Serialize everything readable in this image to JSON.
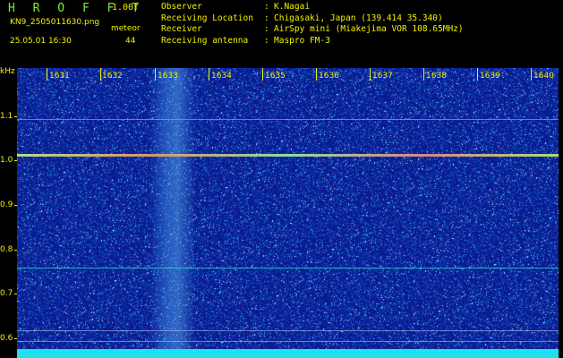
{
  "app": {
    "brand": "H R O F F T",
    "version": "1.00f",
    "filename": "KN9_2505011630.png",
    "station": "meteor",
    "datetime": "25.05.01 16:30",
    "count": "44"
  },
  "info": [
    {
      "label": "Observer",
      "value": "K.Nagai"
    },
    {
      "label": "Receiving Location",
      "value": "Chigasaki, Japan (139.414 35.340)"
    },
    {
      "label": "Receiver",
      "value": "AirSpy mini (Miakejima VOR 108.65MHz)"
    },
    {
      "label": "Receiving antenna",
      "value": "Maspro FM-3"
    }
  ],
  "waterfall": {
    "time_labels": [
      "1631",
      "1632",
      "1633",
      "1634",
      "1635",
      "1636",
      "1637",
      "1638",
      "1639",
      "1640"
    ],
    "y_unit": "kHz",
    "y_labels": [
      "1.1",
      "1.0",
      "0.9",
      "0.8",
      "0.7",
      "0.6"
    ],
    "colors": {
      "background": "#0a1a8a",
      "label": "#f2f200",
      "signal_line": "#c8f080",
      "cyan_line": "#2fd0d0"
    }
  }
}
